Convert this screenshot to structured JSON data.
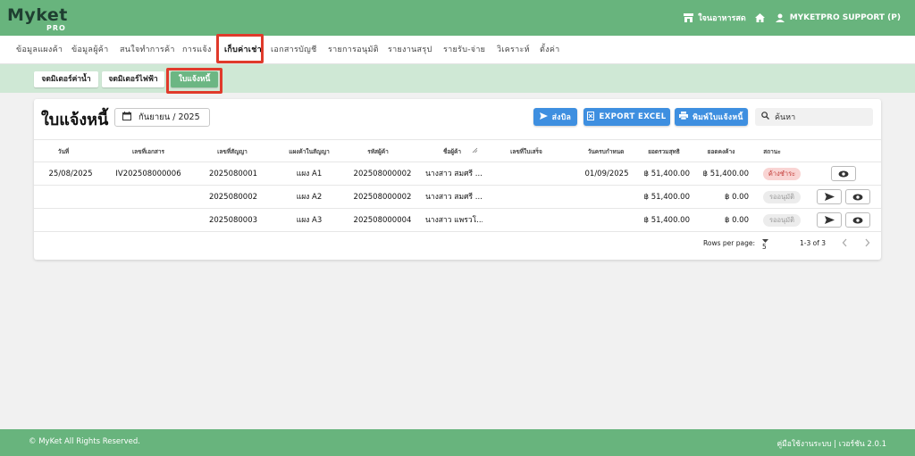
{
  "app": {
    "logo_main": "Myket",
    "logo_sub": "PRO",
    "market_name": "ใจนอาหารสด",
    "user_name": "MYKETPRO SUPPORT (P)"
  },
  "menu": {
    "items": [
      {
        "label": "ข้อมูลแผงค้า"
      },
      {
        "label": "ข้อมูลผู้ค้า"
      },
      {
        "label": "สนใจทำการค้า"
      },
      {
        "label": "การแจ้ง"
      },
      {
        "label": "เก็บค่าเช่า"
      },
      {
        "label": "เอกสารบัญชี"
      },
      {
        "label": "รายการอนุมัติ"
      },
      {
        "label": "รายงานสรุป"
      },
      {
        "label": "รายรับ-จ่าย"
      },
      {
        "label": "วิเคราะห์"
      },
      {
        "label": "ตั้งค่า"
      }
    ],
    "active": "เก็บค่าเช่า"
  },
  "subtabs": [
    {
      "label": "จดมิเตอร์ค่าน้ำ"
    },
    {
      "label": "จดมิเตอร์ไฟฟ้า"
    },
    {
      "label": "ใบแจ้งหนี้"
    }
  ],
  "page": {
    "title": "ใบแจ้งหนี้",
    "month": "กันยายน / 2025",
    "btn_send": "ส่งบิล",
    "btn_export": "EXPORT EXCEL",
    "btn_print": "พิมพ์ใบแจ้งหนี้",
    "search_placeholder": "ค้นหา"
  },
  "table": {
    "headers": [
      "วันที่",
      "เลขที่เอกสาร",
      "เลขที่สัญญา",
      "แผงค้าในสัญญา",
      "รหัสผู้ค้า",
      "ชื่อผู้ค้า",
      "เลขที่ใบเสร็จ",
      "วันครบกำหนด",
      "ยอดรวมสุทธิ",
      "ยอดคงค้าง",
      "สถานะ"
    ],
    "rows": [
      {
        "date": "25/08/2025",
        "doc": "IV202508000006",
        "contract": "2025080001",
        "stall": "แผง A1",
        "code": "202508000002",
        "name": "นางสาว สมศรี ...",
        "receipt": "",
        "due": "01/09/2025",
        "total": "฿ 51,400.00",
        "balance": "฿ 51,400.00",
        "status": "ค้างชำระ"
      },
      {
        "date": "",
        "doc": "",
        "contract": "2025080002",
        "stall": "แผง A2",
        "code": "202508000002",
        "name": "นางสาว สมศรี ...",
        "receipt": "",
        "due": "",
        "total": "฿ 51,400.00",
        "balance": "฿ 0.00",
        "status": "รออนุมัติ"
      },
      {
        "date": "",
        "doc": "",
        "contract": "2025080003",
        "stall": "แผง A3",
        "code": "202508000004",
        "name": "นางสาว แพรวโ...",
        "receipt": "",
        "due": "",
        "total": "฿ 51,400.00",
        "balance": "฿ 0.00",
        "status": "รออนุมัติ"
      }
    ]
  },
  "pager": {
    "rows_label": "Rows per page:",
    "rows_value": "5",
    "range": "1-3 of 3"
  },
  "footer": {
    "left": "© MyKet All Rights Reserved.",
    "right": "คู่มือใช้งานระบบ | เวอร์ชัน 2.0.1"
  },
  "colors": {
    "brand": "#68b47d",
    "highlight": "#e03a2b",
    "button": "#3e8fe0"
  }
}
